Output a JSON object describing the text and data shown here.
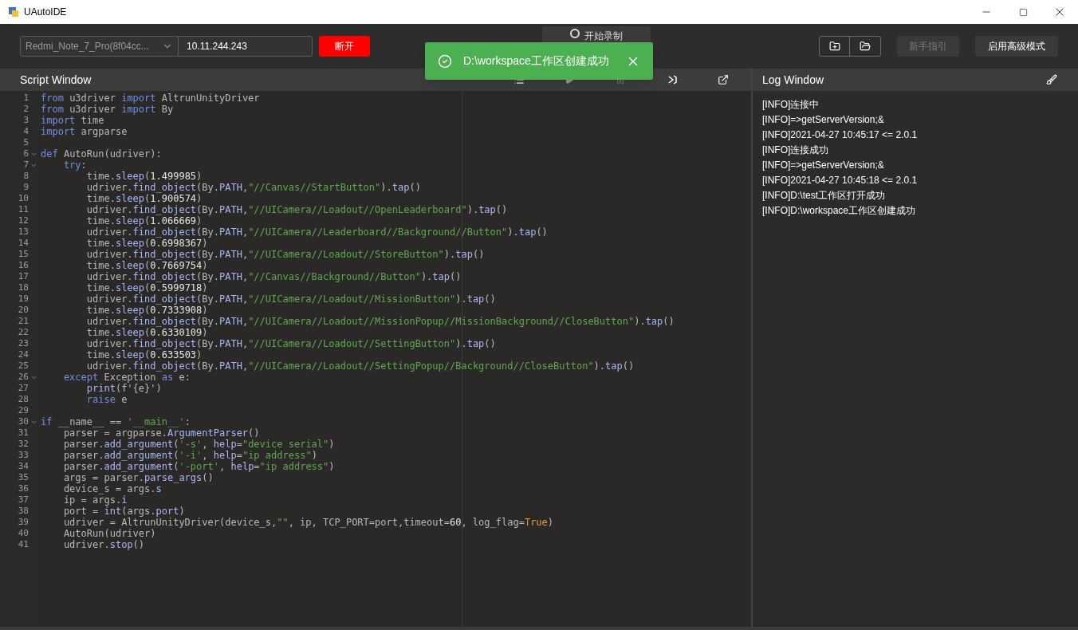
{
  "window": {
    "title": "UAutoIDE"
  },
  "toolbar": {
    "device_select": {
      "value": "Redmi_Note_7_Pro(8f04cc..."
    },
    "ip_field": {
      "value": "10.11.244.243"
    },
    "disconnect_button": "断开",
    "record_button": "开始录制",
    "guide_button": {
      "label": "新手指引",
      "disabled": true
    },
    "advanced_button": {
      "label": "启用高级模式",
      "disabled": false
    }
  },
  "toast": {
    "message": "D:\\workspace工作区创建成功"
  },
  "script_window": {
    "title": "Script Window",
    "lines": [
      {
        "number": "1",
        "fold": false,
        "tokens": [
          {
            "text": "from",
            "kind": "keyword"
          },
          {
            "text": " u3driver ",
            "kind": "plain"
          },
          {
            "text": "import",
            "kind": "keyword"
          },
          {
            "text": " AltrunUnityDriver",
            "kind": "plain"
          }
        ]
      },
      {
        "number": "2",
        "fold": false,
        "tokens": [
          {
            "text": "from",
            "kind": "keyword"
          },
          {
            "text": " u3driver ",
            "kind": "plain"
          },
          {
            "text": "import",
            "kind": "keyword"
          },
          {
            "text": " By",
            "kind": "plain"
          }
        ]
      },
      {
        "number": "3",
        "fold": false,
        "tokens": [
          {
            "text": "import",
            "kind": "keyword"
          },
          {
            "text": " time",
            "kind": "plain"
          }
        ]
      },
      {
        "number": "4",
        "fold": false,
        "tokens": [
          {
            "text": "import",
            "kind": "keyword"
          },
          {
            "text": " argparse",
            "kind": "plain"
          }
        ]
      },
      {
        "number": "5",
        "fold": false
      },
      {
        "number": "6",
        "fold": true,
        "tokens": [
          {
            "text": "def",
            "kind": "keyword"
          },
          {
            "text": " AutoRun(udriver):",
            "kind": "plain"
          }
        ]
      },
      {
        "number": "7",
        "fold": true,
        "tokens": [
          {
            "text": "    try",
            "kind": "keyword"
          },
          {
            "text": ":",
            "kind": "plain"
          }
        ]
      },
      {
        "number": "8",
        "fold": false,
        "tokens": [
          {
            "text": "        time.",
            "kind": "plain"
          },
          {
            "text": "sleep",
            "kind": "method"
          },
          {
            "text": "(",
            "kind": "plain"
          },
          {
            "text": "1.499985",
            "kind": "number"
          },
          {
            "text": ")",
            "kind": "plain"
          }
        ]
      },
      {
        "number": "9",
        "fold": false,
        "tokens": [
          {
            "text": "        udriver.",
            "kind": "plain"
          },
          {
            "text": "find_object",
            "kind": "method"
          },
          {
            "text": "(By.",
            "kind": "plain"
          },
          {
            "text": "PATH",
            "kind": "method"
          },
          {
            "text": ",",
            "kind": "plain"
          },
          {
            "text": "\"//Canvas//StartButton\"",
            "kind": "string"
          },
          {
            "text": ").",
            "kind": "plain"
          },
          {
            "text": "tap",
            "kind": "method"
          },
          {
            "text": "()",
            "kind": "plain"
          }
        ]
      },
      {
        "number": "10",
        "fold": false,
        "tokens": [
          {
            "text": "        time.",
            "kind": "plain"
          },
          {
            "text": "sleep",
            "kind": "method"
          },
          {
            "text": "(",
            "kind": "plain"
          },
          {
            "text": "1.900574",
            "kind": "number"
          },
          {
            "text": ")",
            "kind": "plain"
          }
        ]
      },
      {
        "number": "11",
        "fold": false,
        "tokens": [
          {
            "text": "        udriver.",
            "kind": "plain"
          },
          {
            "text": "find_object",
            "kind": "method"
          },
          {
            "text": "(By.",
            "kind": "plain"
          },
          {
            "text": "PATH",
            "kind": "method"
          },
          {
            "text": ",",
            "kind": "plain"
          },
          {
            "text": "\"//UICamera//Loadout//OpenLeaderboard\"",
            "kind": "string"
          },
          {
            "text": ").",
            "kind": "plain"
          },
          {
            "text": "tap",
            "kind": "method"
          },
          {
            "text": "()",
            "kind": "plain"
          }
        ]
      },
      {
        "number": "12",
        "fold": false,
        "tokens": [
          {
            "text": "        time.",
            "kind": "plain"
          },
          {
            "text": "sleep",
            "kind": "method"
          },
          {
            "text": "(",
            "kind": "plain"
          },
          {
            "text": "1.066669",
            "kind": "number"
          },
          {
            "text": ")",
            "kind": "plain"
          }
        ]
      },
      {
        "number": "13",
        "fold": false,
        "tokens": [
          {
            "text": "        udriver.",
            "kind": "plain"
          },
          {
            "text": "find_object",
            "kind": "method"
          },
          {
            "text": "(By.",
            "kind": "plain"
          },
          {
            "text": "PATH",
            "kind": "method"
          },
          {
            "text": ",",
            "kind": "plain"
          },
          {
            "text": "\"//UICamera//Leaderboard//Background//Button\"",
            "kind": "string"
          },
          {
            "text": ").",
            "kind": "plain"
          },
          {
            "text": "tap",
            "kind": "method"
          },
          {
            "text": "()",
            "kind": "plain"
          }
        ]
      },
      {
        "number": "14",
        "fold": false,
        "tokens": [
          {
            "text": "        time.",
            "kind": "plain"
          },
          {
            "text": "sleep",
            "kind": "method"
          },
          {
            "text": "(",
            "kind": "plain"
          },
          {
            "text": "0.6998367",
            "kind": "number"
          },
          {
            "text": ")",
            "kind": "plain"
          }
        ]
      },
      {
        "number": "15",
        "fold": false,
        "tokens": [
          {
            "text": "        udriver.",
            "kind": "plain"
          },
          {
            "text": "find_object",
            "kind": "method"
          },
          {
            "text": "(By.",
            "kind": "plain"
          },
          {
            "text": "PATH",
            "kind": "method"
          },
          {
            "text": ",",
            "kind": "plain"
          },
          {
            "text": "\"//UICamera//Loadout//StoreButton\"",
            "kind": "string"
          },
          {
            "text": ").",
            "kind": "plain"
          },
          {
            "text": "tap",
            "kind": "method"
          },
          {
            "text": "()",
            "kind": "plain"
          }
        ]
      },
      {
        "number": "16",
        "fold": false,
        "tokens": [
          {
            "text": "        time.",
            "kind": "plain"
          },
          {
            "text": "sleep",
            "kind": "method"
          },
          {
            "text": "(",
            "kind": "plain"
          },
          {
            "text": "0.7669754",
            "kind": "number"
          },
          {
            "text": ")",
            "kind": "plain"
          }
        ]
      },
      {
        "number": "17",
        "fold": false,
        "tokens": [
          {
            "text": "        udriver.",
            "kind": "plain"
          },
          {
            "text": "find_object",
            "kind": "method"
          },
          {
            "text": "(By.",
            "kind": "plain"
          },
          {
            "text": "PATH",
            "kind": "method"
          },
          {
            "text": ",",
            "kind": "plain"
          },
          {
            "text": "\"//Canvas//Background//Button\"",
            "kind": "string"
          },
          {
            "text": ").",
            "kind": "plain"
          },
          {
            "text": "tap",
            "kind": "method"
          },
          {
            "text": "()",
            "kind": "plain"
          }
        ]
      },
      {
        "number": "18",
        "fold": false,
        "tokens": [
          {
            "text": "        time.",
            "kind": "plain"
          },
          {
            "text": "sleep",
            "kind": "method"
          },
          {
            "text": "(",
            "kind": "plain"
          },
          {
            "text": "0.5999718",
            "kind": "number"
          },
          {
            "text": ")",
            "kind": "plain"
          }
        ]
      },
      {
        "number": "19",
        "fold": false,
        "tokens": [
          {
            "text": "        udriver.",
            "kind": "plain"
          },
          {
            "text": "find_object",
            "kind": "method"
          },
          {
            "text": "(By.",
            "kind": "plain"
          },
          {
            "text": "PATH",
            "kind": "method"
          },
          {
            "text": ",",
            "kind": "plain"
          },
          {
            "text": "\"//UICamera//Loadout//MissionButton\"",
            "kind": "string"
          },
          {
            "text": ").",
            "kind": "plain"
          },
          {
            "text": "tap",
            "kind": "method"
          },
          {
            "text": "()",
            "kind": "plain"
          }
        ]
      },
      {
        "number": "20",
        "fold": false,
        "tokens": [
          {
            "text": "        time.",
            "kind": "plain"
          },
          {
            "text": "sleep",
            "kind": "method"
          },
          {
            "text": "(",
            "kind": "plain"
          },
          {
            "text": "0.7333908",
            "kind": "number"
          },
          {
            "text": ")",
            "kind": "plain"
          }
        ]
      },
      {
        "number": "21",
        "fold": false,
        "tokens": [
          {
            "text": "        udriver.",
            "kind": "plain"
          },
          {
            "text": "find_object",
            "kind": "method"
          },
          {
            "text": "(By.",
            "kind": "plain"
          },
          {
            "text": "PATH",
            "kind": "method"
          },
          {
            "text": ",",
            "kind": "plain"
          },
          {
            "text": "\"//UICamera//Loadout//MissionPopup//MissionBackground//CloseButton\"",
            "kind": "string"
          },
          {
            "text": ").",
            "kind": "plain"
          },
          {
            "text": "tap",
            "kind": "method"
          },
          {
            "text": "()",
            "kind": "plain"
          }
        ]
      },
      {
        "number": "22",
        "fold": false,
        "tokens": [
          {
            "text": "        time.",
            "kind": "plain"
          },
          {
            "text": "sleep",
            "kind": "method"
          },
          {
            "text": "(",
            "kind": "plain"
          },
          {
            "text": "0.6330109",
            "kind": "number"
          },
          {
            "text": ")",
            "kind": "plain"
          }
        ]
      },
      {
        "number": "23",
        "fold": false,
        "tokens": [
          {
            "text": "        udriver.",
            "kind": "plain"
          },
          {
            "text": "find_object",
            "kind": "method"
          },
          {
            "text": "(By.",
            "kind": "plain"
          },
          {
            "text": "PATH",
            "kind": "method"
          },
          {
            "text": ",",
            "kind": "plain"
          },
          {
            "text": "\"//UICamera//Loadout//SettingButton\"",
            "kind": "string"
          },
          {
            "text": ").",
            "kind": "plain"
          },
          {
            "text": "tap",
            "kind": "method"
          },
          {
            "text": "()",
            "kind": "plain"
          }
        ]
      },
      {
        "number": "24",
        "fold": false,
        "tokens": [
          {
            "text": "        time.",
            "kind": "plain"
          },
          {
            "text": "sleep",
            "kind": "method"
          },
          {
            "text": "(",
            "kind": "plain"
          },
          {
            "text": "0.633503",
            "kind": "number"
          },
          {
            "text": ")",
            "kind": "plain"
          }
        ]
      },
      {
        "number": "25",
        "fold": false,
        "tokens": [
          {
            "text": "        udriver.",
            "kind": "plain"
          },
          {
            "text": "find_object",
            "kind": "method"
          },
          {
            "text": "(By.",
            "kind": "plain"
          },
          {
            "text": "PATH",
            "kind": "method"
          },
          {
            "text": ",",
            "kind": "plain"
          },
          {
            "text": "\"//UICamera//Loadout//SettingPopup//Background//CloseButton\"",
            "kind": "string"
          },
          {
            "text": ").",
            "kind": "plain"
          },
          {
            "text": "tap",
            "kind": "method"
          },
          {
            "text": "()",
            "kind": "plain"
          }
        ]
      },
      {
        "number": "26",
        "fold": true,
        "tokens": [
          {
            "text": "    except",
            "kind": "keyword"
          },
          {
            "text": " Exception ",
            "kind": "plain"
          },
          {
            "text": "as",
            "kind": "keyword"
          },
          {
            "text": " e:",
            "kind": "plain"
          }
        ]
      },
      {
        "number": "27",
        "fold": false,
        "tokens": [
          {
            "text": "        print",
            "kind": "method"
          },
          {
            "text": "(f'{e}')",
            "kind": "plain"
          }
        ]
      },
      {
        "number": "28",
        "fold": false,
        "tokens": [
          {
            "text": "        raise",
            "kind": "keyword"
          },
          {
            "text": " e",
            "kind": "plain"
          }
        ]
      },
      {
        "number": "29",
        "fold": false
      },
      {
        "number": "30",
        "fold": true,
        "tokens": [
          {
            "text": "if",
            "kind": "keyword"
          },
          {
            "text": " __name__ == ",
            "kind": "plain"
          },
          {
            "text": "'__main__'",
            "kind": "string"
          },
          {
            "text": ":",
            "kind": "plain"
          }
        ]
      },
      {
        "number": "31",
        "fold": false,
        "tokens": [
          {
            "text": "    parser = argparse.",
            "kind": "plain"
          },
          {
            "text": "ArgumentParser",
            "kind": "method"
          },
          {
            "text": "()",
            "kind": "plain"
          }
        ]
      },
      {
        "number": "32",
        "fold": false,
        "tokens": [
          {
            "text": "    parser.",
            "kind": "plain"
          },
          {
            "text": "add_argument",
            "kind": "method"
          },
          {
            "text": "(",
            "kind": "plain"
          },
          {
            "text": "'-s'",
            "kind": "string"
          },
          {
            "text": ", ",
            "kind": "plain"
          },
          {
            "text": "help",
            "kind": "method"
          },
          {
            "text": "=",
            "kind": "plain"
          },
          {
            "text": "\"device serial\"",
            "kind": "string"
          },
          {
            "text": ")",
            "kind": "plain"
          }
        ]
      },
      {
        "number": "33",
        "fold": false,
        "tokens": [
          {
            "text": "    parser.",
            "kind": "plain"
          },
          {
            "text": "add_argument",
            "kind": "method"
          },
          {
            "text": "(",
            "kind": "plain"
          },
          {
            "text": "'-i'",
            "kind": "string"
          },
          {
            "text": ", ",
            "kind": "plain"
          },
          {
            "text": "help",
            "kind": "method"
          },
          {
            "text": "=",
            "kind": "plain"
          },
          {
            "text": "\"ip address\"",
            "kind": "string"
          },
          {
            "text": ")",
            "kind": "plain"
          }
        ]
      },
      {
        "number": "34",
        "fold": false,
        "tokens": [
          {
            "text": "    parser.",
            "kind": "plain"
          },
          {
            "text": "add_argument",
            "kind": "method"
          },
          {
            "text": "(",
            "kind": "plain"
          },
          {
            "text": "'-port'",
            "kind": "string"
          },
          {
            "text": ", ",
            "kind": "plain"
          },
          {
            "text": "help",
            "kind": "method"
          },
          {
            "text": "=",
            "kind": "plain"
          },
          {
            "text": "\"ip address\"",
            "kind": "string"
          },
          {
            "text": ")",
            "kind": "plain"
          }
        ]
      },
      {
        "number": "35",
        "fold": false,
        "tokens": [
          {
            "text": "    args = parser.",
            "kind": "plain"
          },
          {
            "text": "parse_args",
            "kind": "method"
          },
          {
            "text": "()",
            "kind": "plain"
          }
        ]
      },
      {
        "number": "36",
        "fold": false,
        "tokens": [
          {
            "text": "    device_s = args.",
            "kind": "plain"
          },
          {
            "text": "s",
            "kind": "method"
          }
        ]
      },
      {
        "number": "37",
        "fold": false,
        "tokens": [
          {
            "text": "    ip = args.",
            "kind": "plain"
          },
          {
            "text": "i",
            "kind": "method"
          }
        ]
      },
      {
        "number": "38",
        "fold": false,
        "tokens": [
          {
            "text": "    port = ",
            "kind": "plain"
          },
          {
            "text": "int",
            "kind": "method"
          },
          {
            "text": "(args.",
            "kind": "plain"
          },
          {
            "text": "port",
            "kind": "method"
          },
          {
            "text": ")",
            "kind": "plain"
          }
        ]
      },
      {
        "number": "39",
        "fold": false,
        "tokens": [
          {
            "text": "    udriver = AltrunUnityDriver(device_s,",
            "kind": "plain"
          },
          {
            "text": "\"\"",
            "kind": "string"
          },
          {
            "text": ", ip, TCP_PORT=port,timeout=",
            "kind": "plain"
          },
          {
            "text": "60",
            "kind": "number"
          },
          {
            "text": ", log_flag=",
            "kind": "plain"
          },
          {
            "text": "True",
            "kind": "constant"
          },
          {
            "text": ")",
            "kind": "plain"
          }
        ]
      },
      {
        "number": "40",
        "fold": false,
        "tokens": [
          {
            "text": "    AutoRun(udriver)",
            "kind": "plain"
          }
        ]
      },
      {
        "number": "41",
        "fold": false,
        "tokens": [
          {
            "text": "    udriver.",
            "kind": "plain"
          },
          {
            "text": "stop",
            "kind": "method"
          },
          {
            "text": "()",
            "kind": "plain"
          }
        ]
      }
    ]
  },
  "log_window": {
    "title": "Log Window",
    "lines": [
      "[INFO]连接中",
      "[INFO]=>getServerVersion;&",
      "[INFO]2021-04-27 10:45:17 <= 2.0.1",
      "[INFO]连接成功",
      "[INFO]=>getServerVersion;&",
      "[INFO]2021-04-27 10:45:18 <= 2.0.1",
      "[INFO]D:\\test工作区打开成功",
      "[INFO]D:\\workspace工作区创建成功"
    ]
  }
}
